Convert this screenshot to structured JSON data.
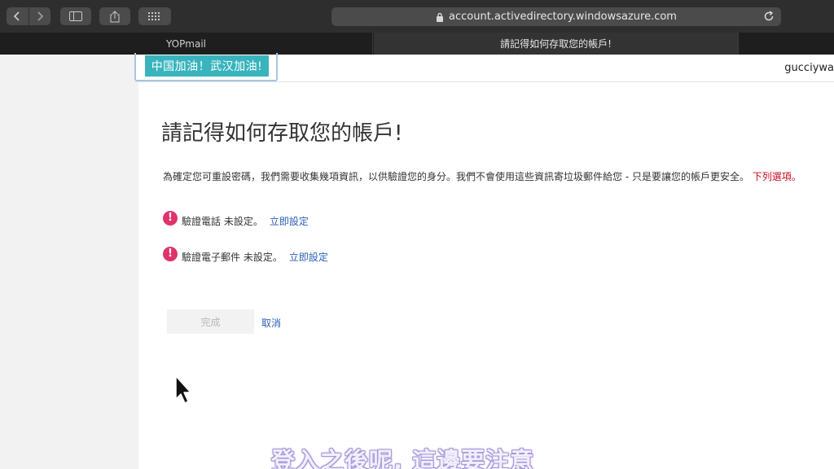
{
  "browser": {
    "url": "account.activedirectory.windowsazure.com",
    "tabs": [
      {
        "label": "YOPmail"
      },
      {
        "label": "請記得如何存取您的帳戶!"
      }
    ]
  },
  "header": {
    "logo_text": "中国加油！武汉加油!",
    "user_name": "gucciywa"
  },
  "main": {
    "title": "請記得如何存取您的帳戶!",
    "description": "為確定您可重設密碼，我們需要收集幾項資訊，以供驗證您的身分。我們不會使用這些資訊寄垃圾郵件給您 - 只是要讓您的帳戶更安全。",
    "description_warning": "下列選項。",
    "items": [
      {
        "label": "驗證電話 未設定。",
        "link": "立即設定"
      },
      {
        "label": "驗證電子郵件 未設定。",
        "link": "立即設定"
      }
    ],
    "done_label": "完成",
    "cancel_label": "取消"
  },
  "overlay": {
    "subtitle": "登入之後呢, 這邊要注意"
  },
  "colors": {
    "logo_banner": "#39b4bd",
    "alert": "#e0336b",
    "link": "#2b5fb4",
    "warning": "#c50f1f"
  }
}
